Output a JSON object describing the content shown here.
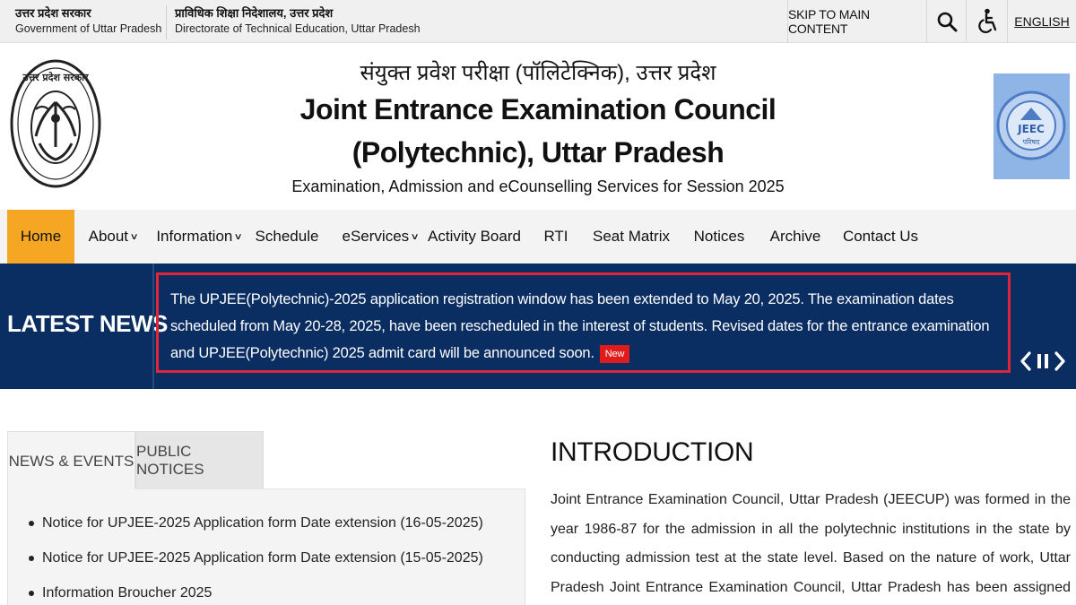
{
  "topbar": {
    "gov_hindi": "उत्तर प्रदेश सरकार",
    "gov_english": "Government of Uttar Pradesh",
    "dept_hindi": "प्राविधिक शिक्षा निदेशालय, उत्तर प्रदेश",
    "dept_english": "Directorate of Technical Education, Uttar Pradesh",
    "skip_link": "SKIP TO MAIN CONTENT",
    "search_icon": "search-icon",
    "accessibility_icon": "accessibility-icon",
    "language": "ENGLISH"
  },
  "header": {
    "title_hindi": "संयुक्त प्रवेश परीक्षा (पॉलिटेक्निक), उत्तर प्रदेश",
    "title_line1": "Joint Entrance Examination Council",
    "title_line2": "(Polytechnic), Uttar Pradesh",
    "subtitle": "Examination, Admission and eCounselling Services for Session 2025",
    "left_emblem_text": "उत्तर प्रदेश सरकार",
    "right_logo_text": "JEEC",
    "right_logo_sub": "परिषद"
  },
  "nav": {
    "items": [
      {
        "label": "Home",
        "dropdown": false
      },
      {
        "label": "About",
        "dropdown": true
      },
      {
        "label": "Information",
        "dropdown": true
      },
      {
        "label": "Schedule",
        "dropdown": false
      },
      {
        "label": "eServices",
        "dropdown": true
      },
      {
        "label": "Activity Board",
        "dropdown": false
      },
      {
        "label": "RTI",
        "dropdown": false
      },
      {
        "label": "Seat Matrix",
        "dropdown": false
      },
      {
        "label": "Notices",
        "dropdown": false
      },
      {
        "label": "Archive",
        "dropdown": false
      },
      {
        "label": "Contact Us",
        "dropdown": false
      }
    ],
    "active": "Home",
    "active_color": "#f5a623"
  },
  "news": {
    "label": "LATEST NEWS",
    "text": "The UPJEE(Polytechnic)-2025 application registration window has been extended to May 20, 2025. The examination dates scheduled from May 20-28, 2025, have been rescheduled in the interest of students. Revised dates for the entrance examination and UPJEE(Polytechnic) 2025 admit card will be announced soon.",
    "badge": "New",
    "background_color": "#0a2d62",
    "highlight_color": "#e0243a"
  },
  "tabs": {
    "items": [
      "NEWS & EVENTS",
      "PUBLIC NOTICES"
    ],
    "active": "NEWS & EVENTS"
  },
  "notices": [
    "Notice for UPJEE-2025 Application form Date extension (16-05-2025)",
    "Notice for UPJEE-2025 Application form Date extension (15-05-2025)",
    "Information Broucher 2025"
  ],
  "intro": {
    "title": "INTRODUCTION",
    "text": "Joint Entrance Examination Council, Uttar Pradesh (JEECUP) was formed in the year 1986-87 for the admission in all the polytechnic institutions in the state by conducting admission test at the state level. Based on the nature of work, Uttar Pradesh Joint Entrance Examination Council, Uttar Pradesh has been assigned the responsibility to conduct the Uttar Pradesh"
  }
}
